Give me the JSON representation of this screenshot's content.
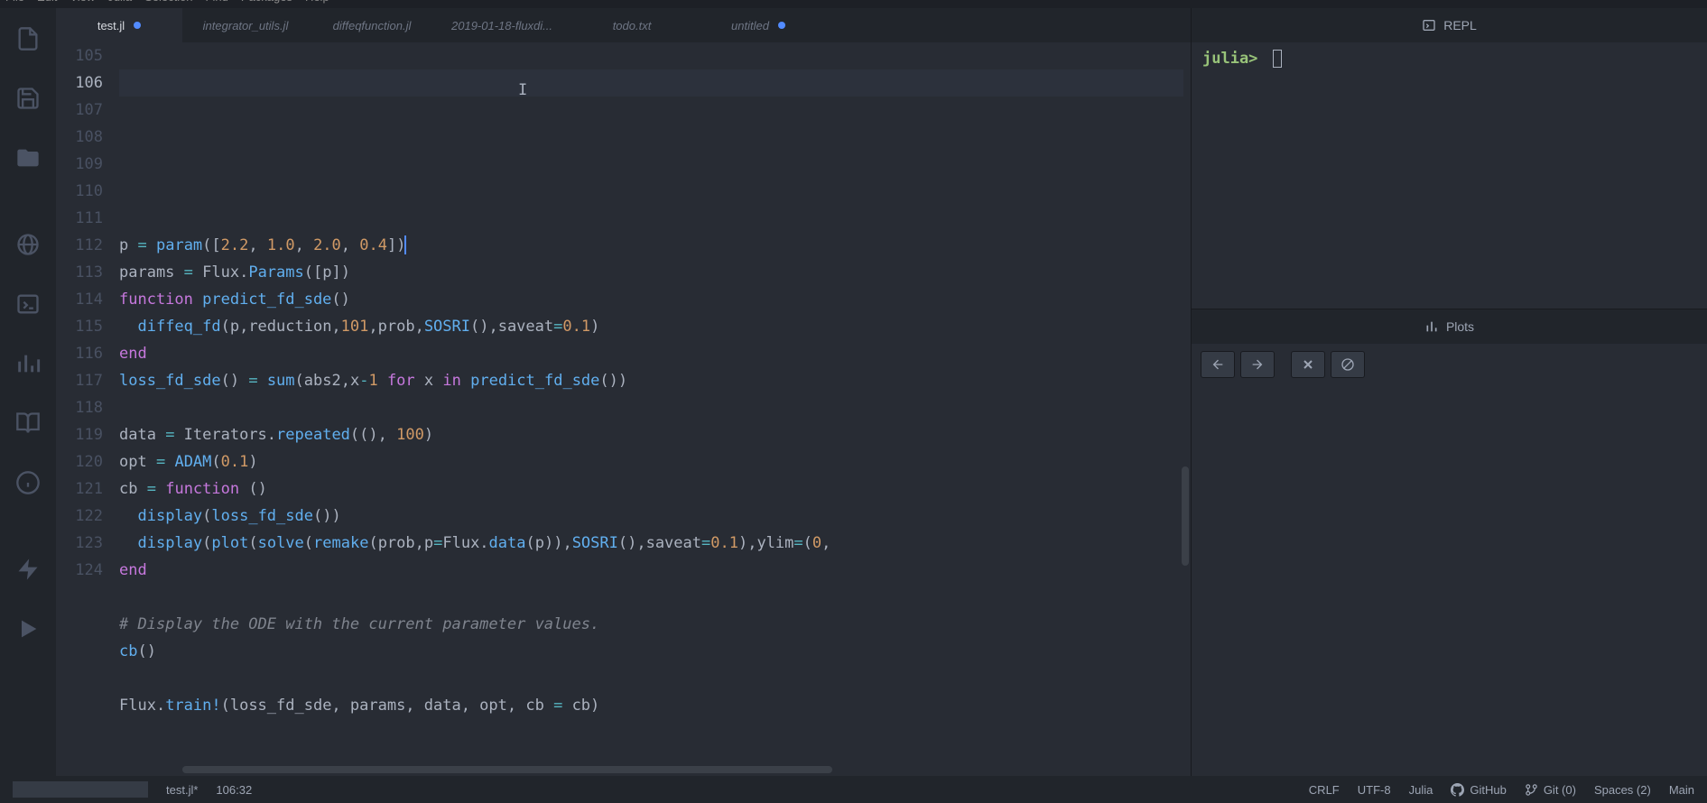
{
  "menu": {
    "items": [
      "File",
      "Edit",
      "View",
      "Julia",
      "Selection",
      "Find",
      "Packages",
      "Help"
    ]
  },
  "tabs": [
    {
      "label": "test.jl",
      "active": true,
      "modified": true
    },
    {
      "label": "integrator_utils.jl",
      "active": false,
      "modified": false
    },
    {
      "label": "diffeqfunction.jl",
      "active": false,
      "modified": false
    },
    {
      "label": "2019-01-18-fluxdi...",
      "active": false,
      "modified": false
    },
    {
      "label": "todo.txt",
      "active": false,
      "modified": false
    },
    {
      "label": "untitled",
      "active": false,
      "modified": true
    }
  ],
  "gutter": {
    "start": 105,
    "end": 124,
    "active": 106
  },
  "code": {
    "l105": "",
    "l106_a": "p ",
    "l106_op": "=",
    "l106_b": " ",
    "l106_fn": "param",
    "l106_c": "(",
    "l106_d": "[",
    "l106_n1": "2.2",
    "l106_n2": "1.0",
    "l106_n3": "2.0",
    "l106_n4": "0.4",
    "l106_e": "]",
    "l106_f": ")",
    "l107_a": "params ",
    "l107_op": "=",
    "l107_b": " Flux.",
    "l107_fn": "Params",
    "l107_c": "([p])",
    "l108_kw": "function",
    "l108_fn": " predict_fd_sde",
    "l108_p": "()",
    "l109_a": "  ",
    "l109_fn": "diffeq_fd",
    "l109_b": "(p,reduction,",
    "l109_n": "101",
    "l109_c": ",prob,",
    "l109_fn2": "SOSRI",
    "l109_d": "(),saveat",
    "l109_op": "=",
    "l109_n2": "0.1",
    "l109_e": ")",
    "l110_kw": "end",
    "l111_fn": "loss_fd_sde",
    "l111_a": "() ",
    "l111_op": "=",
    "l111_b": " ",
    "l111_fn2": "sum",
    "l111_c": "(abs2,x",
    "l111_op2": "-",
    "l111_n": "1",
    "l111_d": " ",
    "l111_kw": "for",
    "l111_e": " x ",
    "l111_kw2": "in",
    "l111_f": " ",
    "l111_fn3": "predict_fd_sde",
    "l111_g": "())",
    "l112": "",
    "l113_a": "data ",
    "l113_op": "=",
    "l113_b": " Iterators.",
    "l113_fn": "repeated",
    "l113_c": "((), ",
    "l113_n": "100",
    "l113_d": ")",
    "l114_a": "opt ",
    "l114_op": "=",
    "l114_b": " ",
    "l114_fn": "ADAM",
    "l114_c": "(",
    "l114_n": "0.1",
    "l114_d": ")",
    "l115_a": "cb ",
    "l115_op": "=",
    "l115_b": " ",
    "l115_kw": "function",
    "l115_c": " ()",
    "l116_a": "  ",
    "l116_fn": "display",
    "l116_b": "(",
    "l116_fn2": "loss_fd_sde",
    "l116_c": "())",
    "l117_a": "  ",
    "l117_fn": "display",
    "l117_b": "(",
    "l117_fn2": "plot",
    "l117_c": "(",
    "l117_fn3": "solve",
    "l117_d": "(",
    "l117_fn4": "remake",
    "l117_e": "(prob,p",
    "l117_op": "=",
    "l117_f": "Flux.",
    "l117_fn5": "data",
    "l117_g": "(p)),",
    "l117_fn6": "SOSRI",
    "l117_h": "(),saveat",
    "l117_op2": "=",
    "l117_n": "0.1",
    "l117_i": "),ylim",
    "l117_op3": "=",
    "l117_j": "(",
    "l117_n2": "0",
    "l117_k": ",",
    "l118_kw": "end",
    "l119": "",
    "l120_c": "# Display the ODE with the current parameter values.",
    "l121_fn": "cb",
    "l121_a": "()",
    "l122": "",
    "l123_a": "Flux.",
    "l123_fn": "train!",
    "l123_b": "(loss_fd_sde, params, data, opt, cb ",
    "l123_op": "=",
    "l123_c": " cb)",
    "l124": ""
  },
  "repl": {
    "title": "REPL",
    "prompt": "julia>"
  },
  "plots": {
    "title": "Plots"
  },
  "status": {
    "file": "test.jl*",
    "cursor": "106:32",
    "eol": "CRLF",
    "encoding": "UTF-8",
    "lang": "Julia",
    "github": "GitHub",
    "git": "Git (0)",
    "spaces": "Spaces (2)",
    "branch": "Main"
  }
}
